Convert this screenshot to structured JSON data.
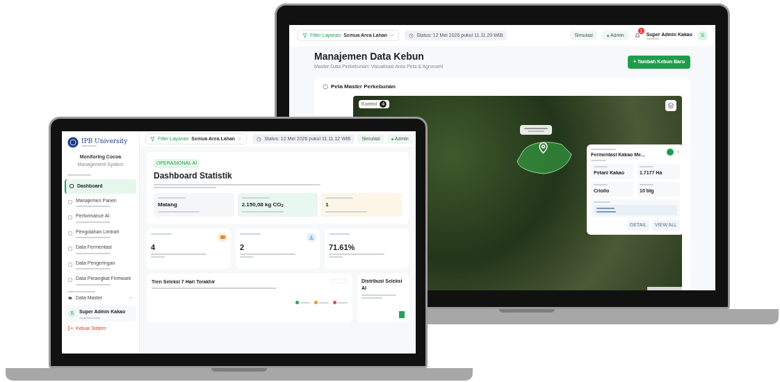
{
  "right_screen": {
    "topbar": {
      "filter_label": "Filter Layanan",
      "filter_value": "Semua Area Lahan",
      "status": "Status: 12 Mei 2026 pukul 11.11.29 WIB",
      "chips": [
        "Simulasi",
        "Admin"
      ],
      "notification_count": "1",
      "user_name": "Super Admin Kakao",
      "avatar": "S"
    },
    "page": {
      "title": "Manajemen Data Kebun",
      "subtitle": "Master Data Perkebunan: Visualisasi Area Peta & Agronomi",
      "add_button": "+ Tambah Kebun Baru"
    },
    "map_card": {
      "title": "Peta Master Perkebunan",
      "control_button": "Kontrol",
      "control_count": "4",
      "popup": {
        "title": "Fermentasi Kakao Me...",
        "fields": [
          {
            "value": "Petani Kakao"
          },
          {
            "value": "1.7177 Ha"
          },
          {
            "value": "Criollo"
          },
          {
            "value": "10 btg"
          }
        ],
        "actions": [
          "DETAIL",
          "VIEW ALL"
        ]
      }
    }
  },
  "left_screen": {
    "brand": {
      "name": "IPB University",
      "app_title": "Monitoring Cocoa",
      "app_subtitle": "Management System"
    },
    "sidebar": {
      "items": [
        {
          "label": "Dashboard",
          "selected": true
        },
        {
          "label": "Manajemen Panen",
          "selected": false
        },
        {
          "label": "Performance AI",
          "selected": false
        },
        {
          "label": "Pengolahan Limbah",
          "selected": false
        },
        {
          "label": "Data Fermentasi",
          "selected": false
        },
        {
          "label": "Data Pengeringan",
          "selected": false
        },
        {
          "label": "Data Perangkat Firmware",
          "selected": false
        }
      ],
      "master_item": "Data Master",
      "user_name": "Super Admin Kakao",
      "avatar": "S",
      "logout": "Keluar Sistem"
    },
    "topbar": {
      "filter_label": "Filter Layanan",
      "filter_value": "Semua Area Lahan",
      "status": "Status: 12 Mei 2026 pukul 11.11.12 WIB",
      "chips": [
        "Simulasi",
        "Admin"
      ]
    },
    "hero": {
      "eyebrow": "OPERASIONAL AI",
      "title": "Dashboard Statistik",
      "cards": [
        {
          "value": "Matang",
          "color": "#f4f6f8"
        },
        {
          "value": "2.150,08 kg CO$_{2}$",
          "color": "#e8f7f0"
        },
        {
          "value": "1",
          "color": "#fdf6e6"
        }
      ]
    },
    "stats": [
      {
        "value": "4"
      },
      {
        "value": "2"
      },
      {
        "value": "71.61%"
      }
    ],
    "trend": {
      "title": "Tren Seleksi 7 Hari Terakhir",
      "legend": [
        {
          "color": "#22a355"
        },
        {
          "color": "#e0a325"
        },
        {
          "color": "#d9534f"
        }
      ]
    },
    "distribution": {
      "title": "Distribusi Seleksi AI"
    }
  }
}
